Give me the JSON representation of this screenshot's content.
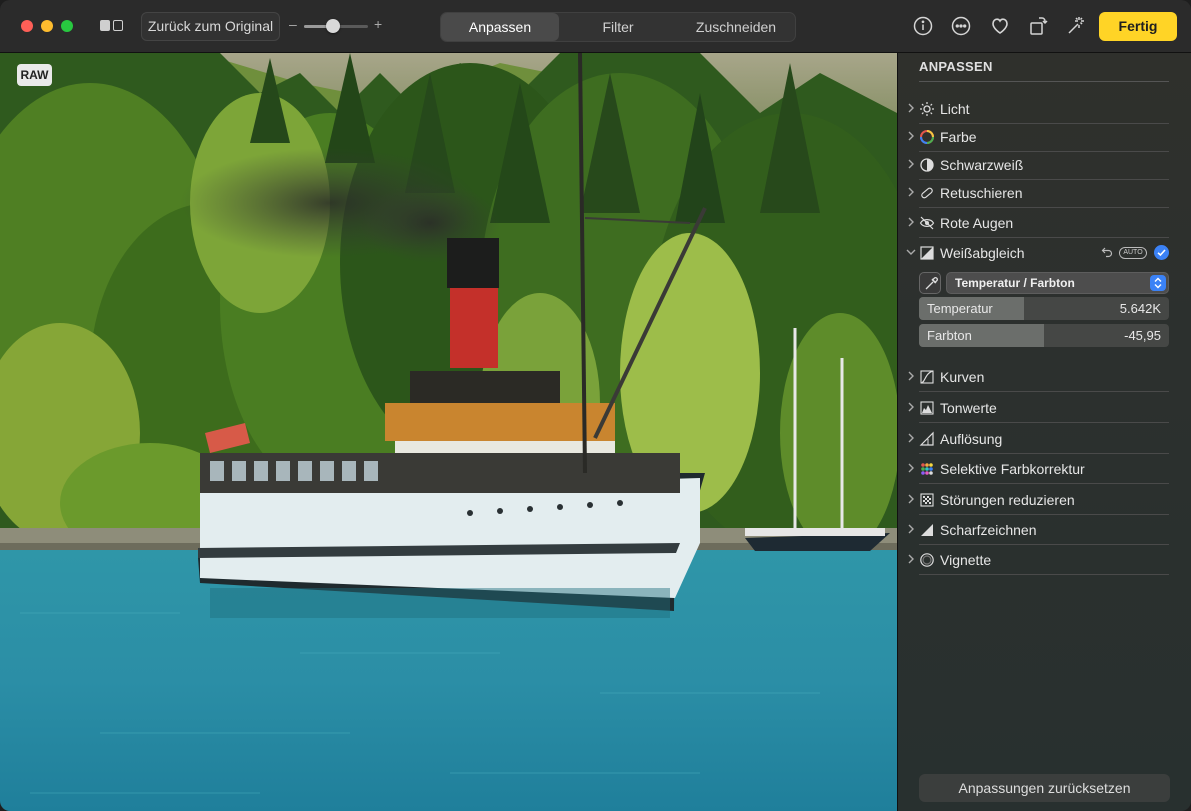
{
  "toolbar": {
    "compare_icon": "split-view-icon",
    "revert_label": "Zurück zum Original",
    "zoom_minus": "–",
    "zoom_plus": "+",
    "zoom_level": 0.45,
    "tabs": [
      {
        "label": "Anpassen",
        "active": true
      },
      {
        "label": "Filter",
        "active": false
      },
      {
        "label": "Zuschneiden",
        "active": false
      }
    ],
    "icons": [
      "info-icon",
      "more-icon",
      "heart-icon",
      "rotate-icon",
      "magic-wand-icon"
    ],
    "done_label": "Fertig",
    "done_color": "#ffd426"
  },
  "photo": {
    "badge": "RAW"
  },
  "sidebar": {
    "title": "ANPASSEN",
    "sections": [
      {
        "label": "Licht",
        "icon": "sun-icon"
      },
      {
        "label": "Farbe",
        "icon": "color-wheel-icon"
      },
      {
        "label": "Schwarzweiß",
        "icon": "half-circle-icon"
      },
      {
        "label": "Retuschieren",
        "icon": "bandage-icon"
      },
      {
        "label": "Rote Augen",
        "icon": "eye-icon"
      },
      {
        "label": "Weißabgleich",
        "icon": "white-balance-icon",
        "expanded": true
      },
      {
        "label": "Kurven",
        "icon": "curves-icon"
      },
      {
        "label": "Tonwerte",
        "icon": "levels-icon"
      },
      {
        "label": "Auflösung",
        "icon": "definition-icon"
      },
      {
        "label": "Selektive Farbkorrektur",
        "icon": "color-dots-icon"
      },
      {
        "label": "Störungen reduzieren",
        "icon": "noise-icon"
      },
      {
        "label": "Scharfzeichnen",
        "icon": "sharpen-icon"
      },
      {
        "label": "Vignette",
        "icon": "vignette-icon"
      }
    ],
    "white_balance": {
      "auto_label": "AUTO",
      "mode": "Temperatur / Farbton",
      "temperature_label": "Temperatur",
      "temperature_value": "5.642K",
      "temperature_fill": 0.42,
      "tint_label": "Farbton",
      "tint_value": "-45,95",
      "tint_fill": 0.5
    },
    "reset_label": "Anpassungen zurücksetzen"
  }
}
